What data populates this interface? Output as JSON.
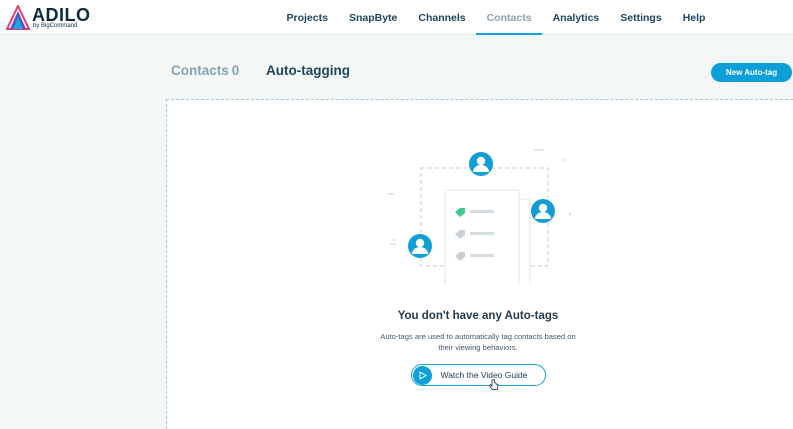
{
  "brand": {
    "name": "ADILO",
    "tagline": "by BigCommand",
    "logo_icon": "adilo-triangle-logo"
  },
  "nav": {
    "items": [
      {
        "label": "Projects",
        "active": false
      },
      {
        "label": "SnapByte",
        "active": false
      },
      {
        "label": "Channels",
        "active": false
      },
      {
        "label": "Contacts",
        "active": true
      },
      {
        "label": "Analytics",
        "active": false
      },
      {
        "label": "Settings",
        "active": false
      },
      {
        "label": "Help",
        "active": false
      }
    ]
  },
  "tabs": {
    "contacts_label": "Contacts",
    "contacts_count": "0",
    "autotagging_label": "Auto-tagging"
  },
  "actions": {
    "new_autotag_label": "New Auto-tag"
  },
  "empty_state": {
    "title": "You don't have any Auto-tags",
    "description": "Auto-tags are used to automatically tag contacts based on their viewing behaviors.",
    "guide_button_label": "Watch the Video Guide",
    "guide_icon": "play-icon"
  },
  "colors": {
    "accent": "#0d9fd8",
    "text_dark": "#21455e",
    "text_muted": "#8aa1ae",
    "page_bg": "#f3f7f5"
  }
}
